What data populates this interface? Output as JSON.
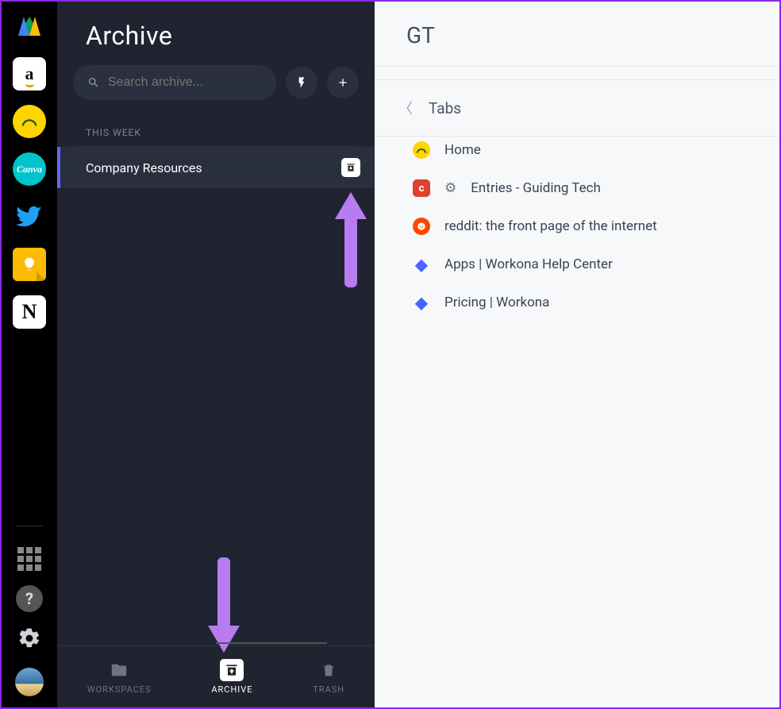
{
  "rail": {
    "items": [
      {
        "name": "google-drive-icon"
      },
      {
        "name": "amazon-icon",
        "letter": "a",
        "bg": "#ffffff",
        "fg": "#111111"
      },
      {
        "name": "basecamp-icon",
        "bg": "#ffd400",
        "fg": "#1a8f3c"
      },
      {
        "name": "canva-icon",
        "label": "Canva",
        "bg": "#00c4cc",
        "fg": "#ffffff"
      },
      {
        "name": "twitter-icon",
        "bg": "transparent",
        "fg": "#1da1f2"
      },
      {
        "name": "google-keep-icon",
        "bg": "#fbbc04",
        "fg": "#ffffff"
      },
      {
        "name": "notion-icon",
        "letter": "N",
        "bg": "#ffffff",
        "fg": "#000000"
      }
    ],
    "bottom": {
      "apps_grid": "apps-grid-icon",
      "help": "?",
      "settings": "gear-icon",
      "avatar": "user-avatar"
    }
  },
  "archive": {
    "title": "Archive",
    "search_placeholder": "Search archive...",
    "bolt_tooltip": "Quick switch",
    "add_tooltip": "Add",
    "sections": [
      {
        "label": "THIS WEEK",
        "items": [
          {
            "name": "Company Resources"
          }
        ]
      }
    ],
    "nav": {
      "workspaces": "WORKSPACES",
      "archive": "ARCHIVE",
      "trash": "TRASH",
      "active": "archive"
    }
  },
  "panel": {
    "title": "GT",
    "subtitle": "Tabs",
    "tabs": [
      {
        "title": "Home",
        "fav_bg": "#ffd400",
        "fav_fg": "#1a8f3c",
        "fav_glyph": "◯"
      },
      {
        "title": "Entries - Guiding Tech",
        "prefix": "⚙",
        "fav_bg": "#e0402f",
        "fav_fg": "#ffffff",
        "fav_glyph": "c"
      },
      {
        "title": "reddit: the front page of the internet",
        "fav_bg": "#ff4500",
        "fav_fg": "#ffffff",
        "fav_glyph": "●"
      },
      {
        "title": "Apps | Workona Help Center",
        "fav_bg": "transparent",
        "fav_fg": "#4a63ff",
        "fav_glyph": "◆"
      },
      {
        "title": "Pricing | Workona",
        "fav_bg": "transparent",
        "fav_fg": "#4a63ff",
        "fav_glyph": "◆"
      }
    ]
  }
}
